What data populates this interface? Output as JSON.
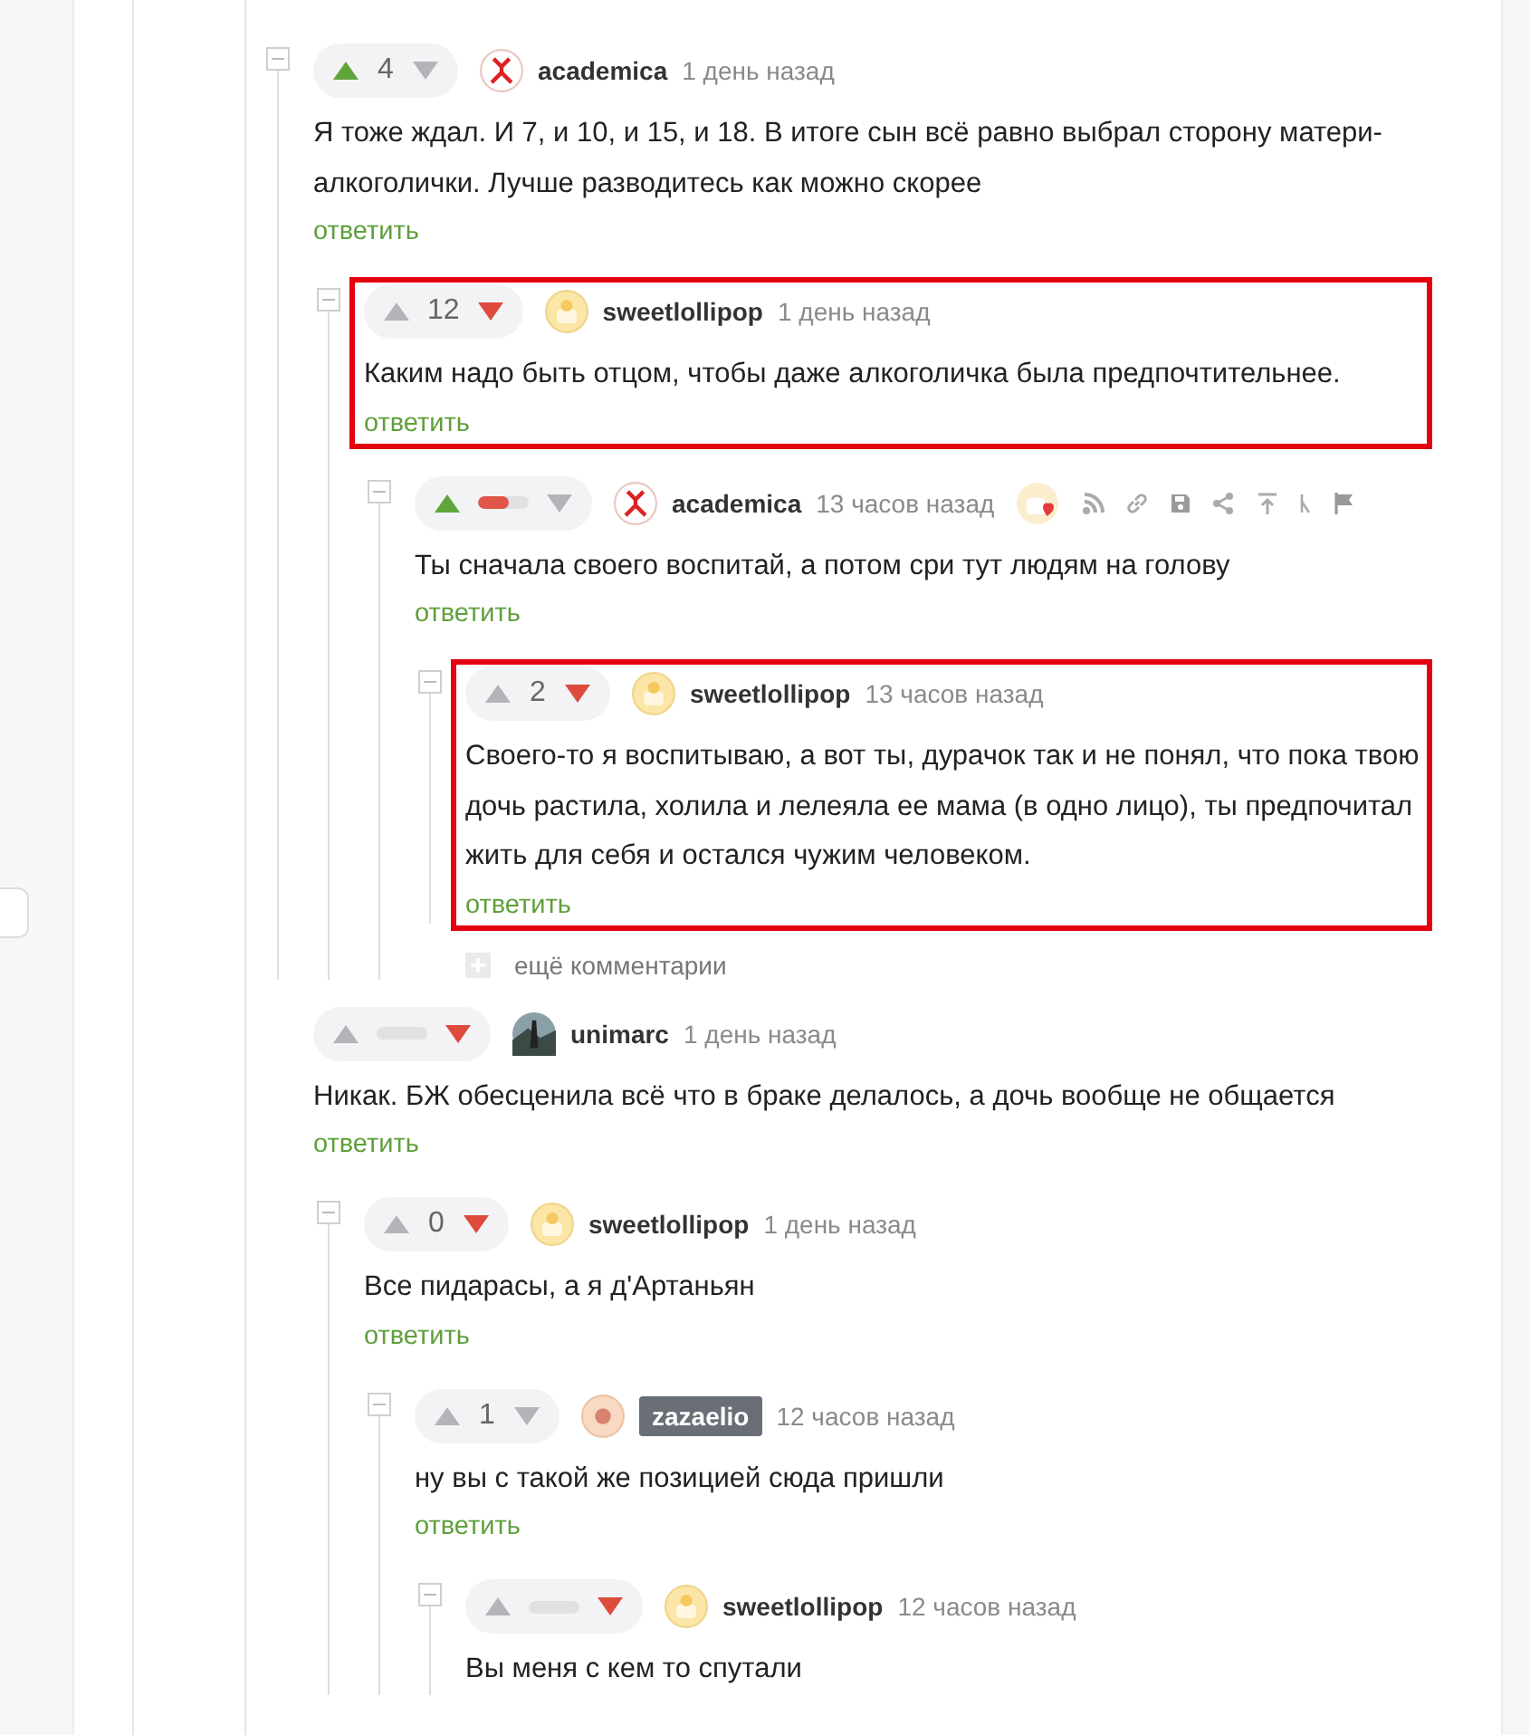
{
  "thread": [
    {
      "collapsible": true,
      "upvoted": true,
      "downvoted": false,
      "kind": "score",
      "rating": "4",
      "avatar": {
        "kind": "emblem"
      },
      "author": "academica",
      "tagged": false,
      "time": "1 день назад",
      "award": false,
      "actions": false,
      "highlighted": false,
      "text": "Я тоже ждал. И 7, и 10, и 15, и 18. В итоге сын всё равно выбрал сторону матери-алкоголички. Лучше разводитесь как можно скорее",
      "reply": "ответить",
      "children": [
        {
          "collapsible": true,
          "upvoted": false,
          "downvoted": true,
          "kind": "score",
          "rating": "12",
          "avatar": {
            "kind": "lollipop"
          },
          "author": "sweetlollipop",
          "tagged": false,
          "time": "1 день назад",
          "award": false,
          "actions": false,
          "highlighted": true,
          "text": "Каким надо быть отцом, чтобы даже алкоголичка была предпочтительнее.",
          "reply": "ответить",
          "children": [
            {
              "collapsible": true,
              "upvoted": true,
              "downvoted": false,
              "kind": "hidden",
              "level": 0.6,
              "avatar": {
                "kind": "emblem"
              },
              "author": "academica",
              "tagged": false,
              "time": "13 часов назад",
              "award": true,
              "actions": true,
              "highlighted": false,
              "text": "Ты сначала своего воспитай, а потом сри тут людям на голову",
              "reply": "ответить",
              "more": "ещё комментарии",
              "children": [
                {
                  "collapsible": true,
                  "upvoted": false,
                  "downvoted": true,
                  "kind": "score",
                  "rating": "2",
                  "avatar": {
                    "kind": "lollipop"
                  },
                  "author": "sweetlollipop",
                  "tagged": false,
                  "time": "13 часов назад",
                  "award": false,
                  "actions": false,
                  "highlighted": true,
                  "text": "Своего-то я воспитываю, а вот ты, дурачок так и не понял, что пока твою дочь растила, холила и лелеяла ее мама (в одно лицо), ты предпочитал жить для себя и остался чужим человеком.",
                  "reply": "ответить"
                }
              ]
            }
          ]
        }
      ]
    },
    {
      "collapsible": false,
      "upvoted": false,
      "downvoted": true,
      "kind": "hidden",
      "level": 0,
      "avatar": {
        "kind": "photo"
      },
      "author": "unimarc",
      "tagged": false,
      "time": "1 день назад",
      "award": false,
      "actions": false,
      "highlighted": false,
      "text": "Никак. БЖ обесценила всё что в браке делалось, а дочь вообще не общается",
      "reply": "ответить",
      "children": [
        {
          "collapsible": true,
          "upvoted": false,
          "downvoted": true,
          "kind": "score",
          "rating": "0",
          "avatar": {
            "kind": "lollipop"
          },
          "author": "sweetlollipop",
          "tagged": false,
          "time": "1 день назад",
          "award": false,
          "actions": false,
          "highlighted": false,
          "text": "Все пидарасы, а я д'Артаньян",
          "reply": "ответить",
          "children": [
            {
              "collapsible": true,
              "upvoted": false,
              "downvoted": false,
              "kind": "score",
              "rating": "1",
              "avatar": {
                "kind": "dot"
              },
              "author": "zazaelio",
              "tagged": true,
              "time": "12 часов назад",
              "award": false,
              "actions": false,
              "highlighted": false,
              "text": "ну вы с такой же позицией сюда пришли",
              "reply": "ответить",
              "children": [
                {
                  "collapsible": true,
                  "upvoted": false,
                  "downvoted": true,
                  "kind": "hidden",
                  "level": 0,
                  "avatar": {
                    "kind": "lollipop"
                  },
                  "author": "sweetlollipop",
                  "tagged": false,
                  "time": "12 часов назад",
                  "award": false,
                  "actions": false,
                  "highlighted": false,
                  "text": "Вы меня с кем то спутали"
                }
              ]
            }
          ]
        }
      ]
    }
  ]
}
